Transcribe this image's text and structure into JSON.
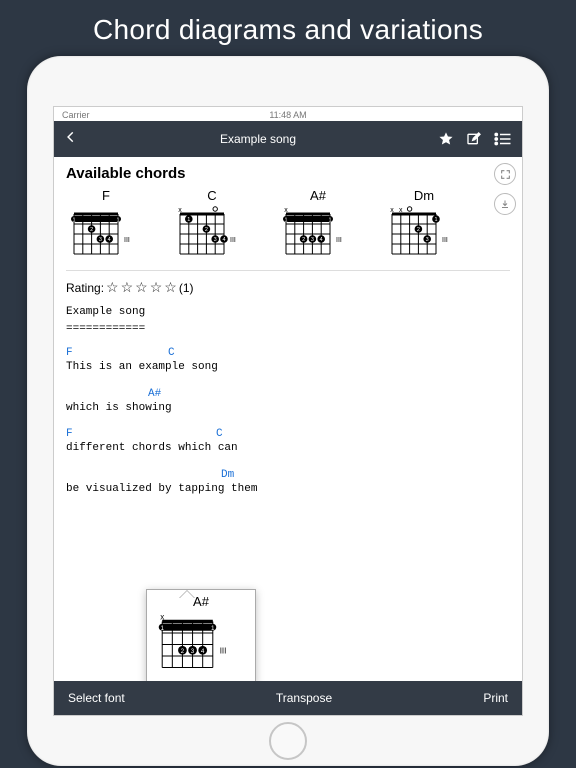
{
  "promo_title": "Chord diagrams and variations",
  "status": {
    "carrier": "Carrier",
    "time": "11:48 AM",
    "right": ""
  },
  "nav": {
    "title": "Example song",
    "actions": {
      "favorite": "star-icon",
      "edit": "compose-icon",
      "list": "list-icon"
    }
  },
  "content": {
    "section_title": "Available chords",
    "chords": [
      {
        "name": "F",
        "fret_label": "III",
        "open_muted": [
          "",
          "",
          "",
          "",
          "",
          ""
        ],
        "barre": {
          "from": 1,
          "to": 6,
          "fret": 1
        },
        "dots": [
          [
            2,
            3
          ],
          [
            3,
            4
          ],
          [
            3,
            5
          ]
        ]
      },
      {
        "name": "C",
        "fret_label": "III",
        "open_muted": [
          "x",
          "",
          "",
          "",
          "o",
          ""
        ],
        "dots": [
          [
            1,
            2
          ],
          [
            2,
            4
          ],
          [
            3,
            5
          ],
          [
            3,
            6
          ]
        ]
      },
      {
        "name": "A#",
        "fret_label": "III",
        "open_muted": [
          "x",
          "",
          "",
          "",
          "",
          ""
        ],
        "barre": {
          "from": 1,
          "to": 6,
          "fret": 1
        },
        "dots": [
          [
            3,
            3
          ],
          [
            3,
            4
          ],
          [
            3,
            5
          ]
        ]
      },
      {
        "name": "Dm",
        "fret_label": "III",
        "open_muted": [
          "x",
          "x",
          "o",
          "",
          "",
          ""
        ],
        "dots": [
          [
            1,
            6
          ],
          [
            2,
            4
          ],
          [
            3,
            5
          ]
        ]
      }
    ],
    "rating_label": "Rating:",
    "rating_count": "(1)",
    "song_title": "Example song",
    "song_divider": "============",
    "lyrics": [
      {
        "chords": [
          [
            "F",
            0
          ],
          [
            "C",
            102
          ]
        ],
        "text": "This is an example song"
      },
      {
        "chords": [
          [
            "A#",
            82
          ]
        ],
        "text": "which is showing"
      },
      {
        "chords": [
          [
            "F",
            0
          ],
          [
            "C",
            150
          ]
        ],
        "text": "different chords which can"
      },
      {
        "chords": [
          [
            "Dm",
            155
          ]
        ],
        "text": "be visualized by tapping them"
      }
    ],
    "popover_chord": {
      "name": "A#",
      "fret_label": "III",
      "open_muted": [
        "x",
        "",
        "",
        "",
        "",
        ""
      ],
      "barre": {
        "from": 1,
        "to": 6,
        "fret": 1
      },
      "dots": [
        [
          3,
          3
        ],
        [
          3,
          4
        ],
        [
          3,
          5
        ]
      ]
    }
  },
  "bottom": {
    "select_font": "Select font",
    "transpose": "Transpose",
    "print": "Print"
  }
}
